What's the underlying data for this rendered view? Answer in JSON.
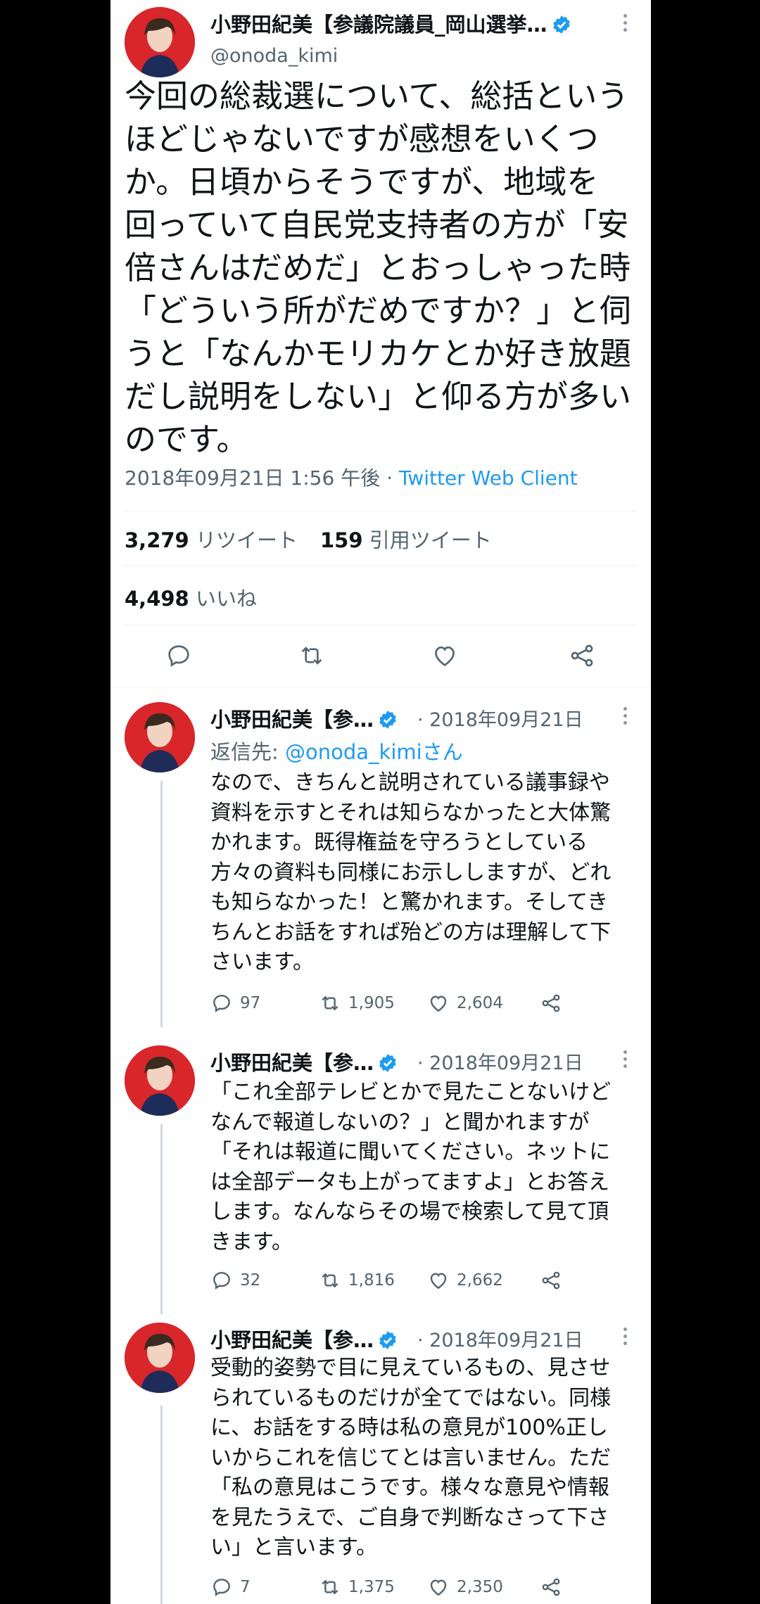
{
  "author": {
    "display_name": "小野田紀美【参議院議員_岡山選挙…",
    "display_name_short": "小野田紀美【参…",
    "handle": "@onoda_kimi"
  },
  "main_tweet": {
    "text_lines": [
      "今回の総裁選について、総括という",
      "ほどじゃないですが感想をいくつ",
      "か。日頃からそうですが、地域を",
      "回っていて自民党支持者の方が「安",
      "倍さんはだめだ」とおっしゃった時",
      "「どういう所がだめですか？」と伺",
      "うと「なんかモリカケとか好き放題",
      "だし説明をしない」と仰る方が多い",
      "のです。"
    ],
    "timestamp": "2018年09月21日 1:56 午後",
    "separator": " · ",
    "source": "Twitter Web Client",
    "retweets": "3,279",
    "retweets_label": "リツイート",
    "quotes": "159",
    "quotes_label": "引用ツイート",
    "likes": "4,498",
    "likes_label": "いいね"
  },
  "replies": [
    {
      "date": "· 2018年09月21日",
      "reply_prefix": "返信先: ",
      "reply_to": "@onoda_kimiさん",
      "text_lines": [
        "なので、きちんと説明されている議事録や",
        "資料を示すとそれは知らなかったと大体驚",
        "かれます。既得権益を守ろうとしている",
        "方々の資料も同様にお示ししますが、どれ",
        "も知らなかった！と驚かれます。そしてき",
        "ちんとお話をすれば殆どの方は理解して下",
        "さいます。"
      ],
      "replies_count": "97",
      "retweets_count": "1,905",
      "likes_count": "2,604"
    },
    {
      "date": "· 2018年09月21日",
      "text_lines": [
        "「これ全部テレビとかで見たことないけど",
        "なんで報道しないの？」と聞かれますが",
        "「それは報道に聞いてください。ネットに",
        "は全部データも上がってますよ」とお答え",
        "します。なんならその場で検索して見て頂",
        "きます。"
      ],
      "replies_count": "32",
      "retweets_count": "1,816",
      "likes_count": "2,662"
    },
    {
      "date": "· 2018年09月21日",
      "text_lines": [
        "受動的姿勢で目に見えているもの、見させ",
        "られているものだけが全てではない。同様",
        "に、お話をする時は私の意見が100%正し",
        "いからこれを信じてとは言いません。ただ",
        "「私の意見はこうです。様々な意見や情報",
        "を見たうえで、ご自身で判断なさって下さ",
        "い」と言います。"
      ],
      "replies_count": "7",
      "retweets_count": "1,375",
      "likes_count": "2,350"
    }
  ],
  "icons": {
    "verified": "verified-badge-icon",
    "more": "more-options-icon",
    "reply": "reply-icon",
    "retweet": "retweet-icon",
    "like": "heart-icon",
    "share": "share-icon"
  },
  "colors": {
    "background": "#ffffff",
    "text": "#0f1419",
    "secondary": "#536471",
    "link": "#1d9bf0",
    "avatar_bg": "#d8262a"
  }
}
